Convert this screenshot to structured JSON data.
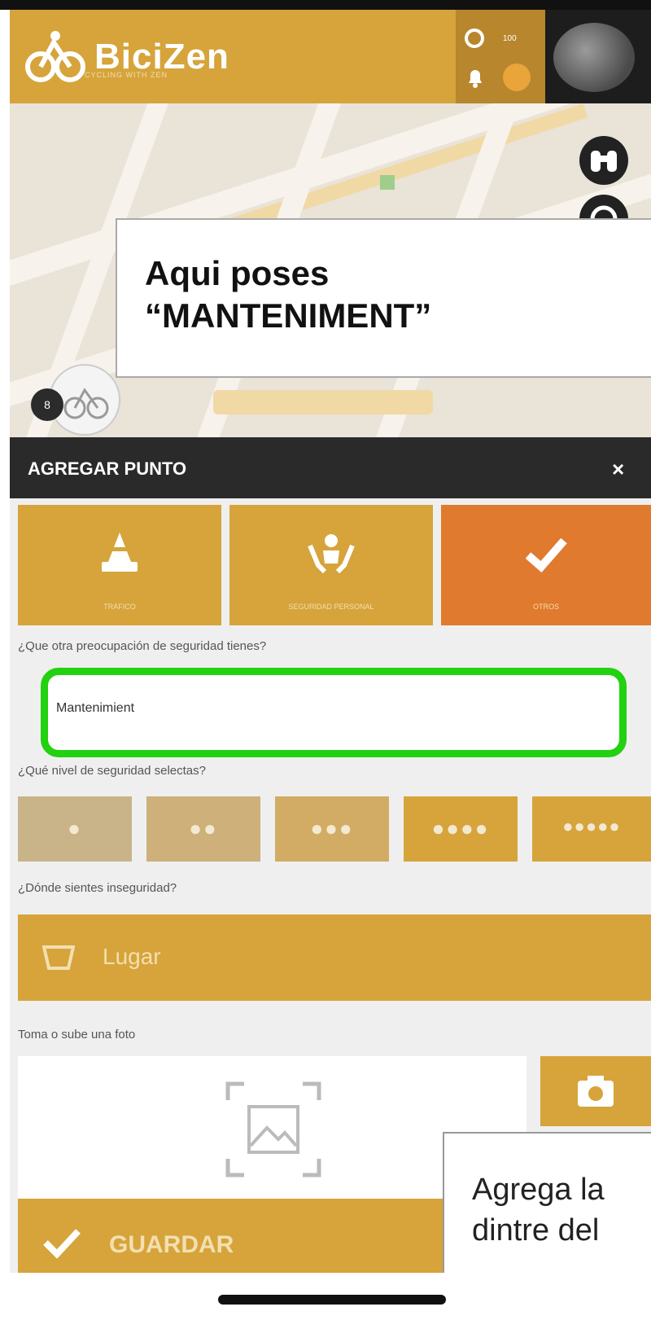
{
  "app": {
    "name": "BiciZen",
    "tagline": "CYCLING WITH ZEN",
    "notification_count": "100"
  },
  "annotations": {
    "top_callout": "Aqui poses\n“MANTENIMENT”",
    "bottom_callout": "Agrega la\ndintre del"
  },
  "panel": {
    "title": "AGREGAR PUNTO",
    "close": "×",
    "categories": [
      {
        "label": "TRÁFICO",
        "icon": "traffic-cone-icon",
        "selected": false
      },
      {
        "label": "SEGURIDAD PERSONAL",
        "icon": "hands-person-icon",
        "selected": false
      },
      {
        "label": "OTROS",
        "icon": "check-icon",
        "selected": true
      }
    ],
    "other_concern_label": "¿Que otra preocupación de seguridad tienes?",
    "other_concern_value": "Mantenimient",
    "level_label": "¿Qué nivel de seguridad selectas?",
    "levels": [
      "●",
      "●●",
      "●●●",
      "●●●●",
      "●●●●●"
    ],
    "where_label": "¿Dónde sientes inseguridad?",
    "place_button": "Lugar",
    "photo_label": "Toma o sube una foto",
    "save_button": "GUARDAR"
  },
  "colors": {
    "accent": "#d6a43b",
    "selected": "#e07a2e",
    "highlight": "#22d10f"
  }
}
